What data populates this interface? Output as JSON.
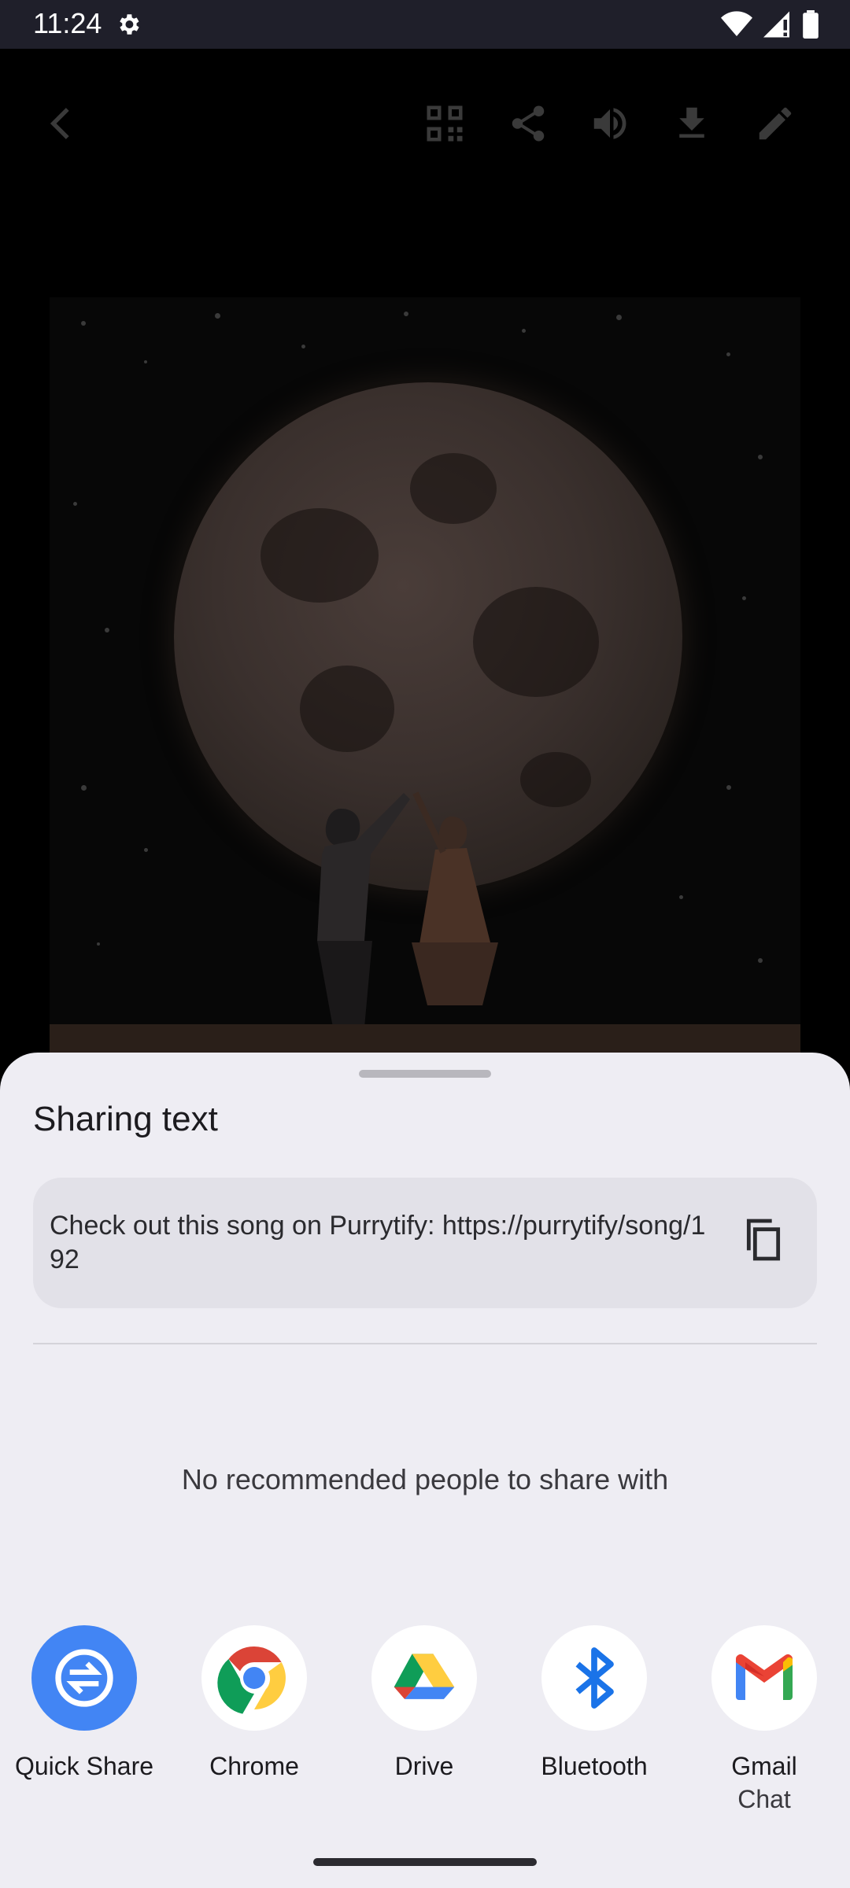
{
  "status_bar": {
    "time": "11:24"
  },
  "sheet": {
    "title": "Sharing text",
    "shared_text": "Check out this song on Purrytify: https://purrytify/song/192",
    "empty_people_message": "No recommended people to share with",
    "targets": [
      {
        "label": "Quick Share",
        "sub": ""
      },
      {
        "label": "Chrome",
        "sub": ""
      },
      {
        "label": "Drive",
        "sub": ""
      },
      {
        "label": "Bluetooth",
        "sub": ""
      },
      {
        "label": "Gmail",
        "sub": "Chat"
      }
    ]
  },
  "colors": {
    "sheet_bg": "#eeedf3",
    "quick_share_blue": "#4285f4",
    "status_bar_bg": "#1f1f2a"
  }
}
